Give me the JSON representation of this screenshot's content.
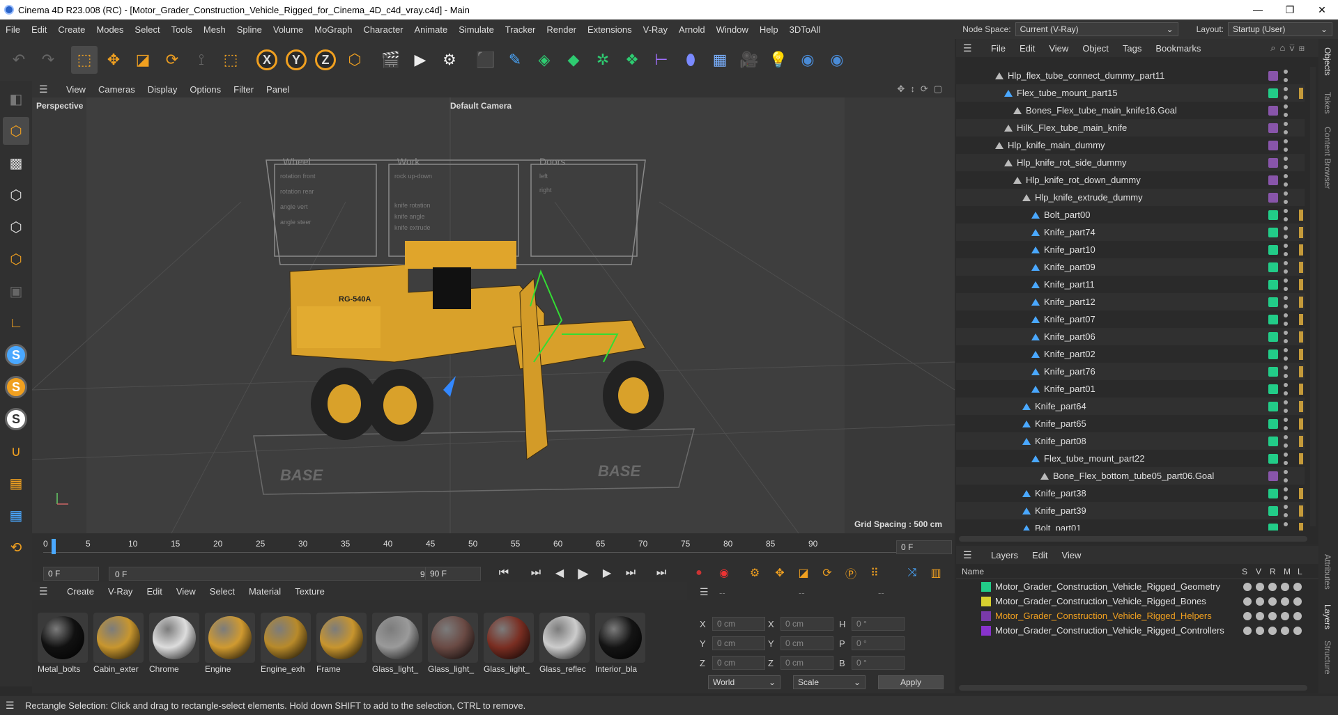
{
  "window": {
    "title": "Cinema 4D R23.008 (RC) - [Motor_Grader_Construction_Vehicle_Rigged_for_Cinema_4D_c4d_vray.c4d] - Main",
    "controls": [
      "—",
      "❐",
      "✕"
    ]
  },
  "menu": {
    "items": [
      "File",
      "Edit",
      "Create",
      "Modes",
      "Select",
      "Tools",
      "Mesh",
      "Spline",
      "Volume",
      "MoGraph",
      "Character",
      "Animate",
      "Simulate",
      "Tracker",
      "Render",
      "Extensions",
      "V-Ray",
      "Arnold",
      "Window",
      "Help",
      "3DToAll"
    ],
    "node_space_label": "Node Space:",
    "node_space_value": "Current (V-Ray)",
    "layout_label": "Layout:",
    "layout_value": "Startup (User)"
  },
  "viewport": {
    "menu": [
      "View",
      "Cameras",
      "Display",
      "Options",
      "Filter",
      "Panel"
    ],
    "view_name": "Perspective",
    "camera": "Default Camera",
    "grid_spacing": "Grid Spacing : 500 cm",
    "model_label": "RG-540A",
    "board": {
      "sections": [
        "Wheel",
        "Work",
        "Doors"
      ],
      "wheel_items": [
        "rotation front",
        "rotation rear",
        "angle vert",
        "angle steer"
      ],
      "work_items": [
        "rock up-down",
        "knife rotation",
        "knife angle",
        "knife extrude"
      ],
      "door_items": [
        "left",
        "right"
      ],
      "base_label": "BASE"
    }
  },
  "timeline": {
    "ticks": [
      "0",
      "5",
      "10",
      "15",
      "20",
      "25",
      "30",
      "35",
      "40",
      "45",
      "50",
      "55",
      "60",
      "65",
      "70",
      "75",
      "80",
      "85",
      "90"
    ],
    "current_frame": "0 F",
    "start_frame": "0 F",
    "range_start": "0 F",
    "range_end": "90 F",
    "end_frame": "90 F"
  },
  "materials": {
    "menu": [
      "Create",
      "V-Ray",
      "Edit",
      "View",
      "Select",
      "Material",
      "Texture"
    ],
    "items": [
      {
        "name": "Metal_bolts",
        "color": "#111111"
      },
      {
        "name": "Cabin_exter",
        "color": "#c8962e"
      },
      {
        "name": "Chrome",
        "color": "#dddddd"
      },
      {
        "name": "Engine",
        "color": "#d09a30"
      },
      {
        "name": "Engine_exh",
        "color": "#b88a2a"
      },
      {
        "name": "Frame",
        "color": "#c8952e"
      },
      {
        "name": "Glass_light_",
        "color": "#9a9a9a"
      },
      {
        "name": "Glass_light_",
        "color": "#6a4a44"
      },
      {
        "name": "Glass_light_",
        "color": "#7a2e22"
      },
      {
        "name": "Glass_reflec",
        "color": "#cccccc"
      },
      {
        "name": "Interior_bla",
        "color": "#141414"
      }
    ]
  },
  "coords": {
    "headers": [
      "--",
      "--",
      "--"
    ],
    "rows": [
      {
        "a": "X",
        "av": "0 cm",
        "b": "X",
        "bv": "0 cm",
        "c": "H",
        "cv": "0 °"
      },
      {
        "a": "Y",
        "av": "0 cm",
        "b": "Y",
        "bv": "0 cm",
        "c": "P",
        "cv": "0 °"
      },
      {
        "a": "Z",
        "av": "0 cm",
        "b": "Z",
        "bv": "0 cm",
        "c": "B",
        "cv": "0 °"
      }
    ],
    "mode": "World",
    "transform": "Scale",
    "apply": "Apply"
  },
  "objects": {
    "menu": [
      "File",
      "Edit",
      "View",
      "Object",
      "Tags",
      "Bookmarks"
    ],
    "rows": [
      {
        "name": "Hlp_flex_tube_connect_dummy_part11",
        "chip": "#8855aa",
        "depth": 0
      },
      {
        "name": "Flex_tube_mount_part15",
        "chip": "#22cc88",
        "depth": 1
      },
      {
        "name": "Bones_Flex_tube_main_knife16.Goal",
        "chip": "#8855aa",
        "depth": 2
      },
      {
        "name": "HilK_Flex_tube_main_knife",
        "chip": "#8855aa",
        "depth": 1
      },
      {
        "name": "Hlp_knife_main_dummy",
        "chip": "#8855aa",
        "depth": 0
      },
      {
        "name": "Hlp_knife_rot_side_dummy",
        "chip": "#8855aa",
        "depth": 1
      },
      {
        "name": "Hlp_knife_rot_down_dummy",
        "chip": "#8855aa",
        "depth": 2
      },
      {
        "name": "Hlp_knife_extrude_dummy",
        "chip": "#8855aa",
        "depth": 3
      },
      {
        "name": "Bolt_part00",
        "chip": "#22cc88",
        "depth": 4
      },
      {
        "name": "Knife_part74",
        "chip": "#22cc88",
        "depth": 4
      },
      {
        "name": "Knife_part10",
        "chip": "#22cc88",
        "depth": 4
      },
      {
        "name": "Knife_part09",
        "chip": "#22cc88",
        "depth": 4
      },
      {
        "name": "Knife_part11",
        "chip": "#22cc88",
        "depth": 4
      },
      {
        "name": "Knife_part12",
        "chip": "#22cc88",
        "depth": 4
      },
      {
        "name": "Knife_part07",
        "chip": "#22cc88",
        "depth": 4
      },
      {
        "name": "Knife_part06",
        "chip": "#22cc88",
        "depth": 4
      },
      {
        "name": "Knife_part02",
        "chip": "#22cc88",
        "depth": 4
      },
      {
        "name": "Knife_part76",
        "chip": "#22cc88",
        "depth": 4
      },
      {
        "name": "Knife_part01",
        "chip": "#22cc88",
        "depth": 4
      },
      {
        "name": "Knife_part64",
        "chip": "#22cc88",
        "depth": 3
      },
      {
        "name": "Knife_part65",
        "chip": "#22cc88",
        "depth": 3
      },
      {
        "name": "Knife_part08",
        "chip": "#22cc88",
        "depth": 3
      },
      {
        "name": "Flex_tube_mount_part22",
        "chip": "#22cc88",
        "depth": 4
      },
      {
        "name": "Bone_Flex_bottom_tube05_part06.Goal",
        "chip": "#8855aa",
        "depth": 5
      },
      {
        "name": "Knife_part38",
        "chip": "#22cc88",
        "depth": 3
      },
      {
        "name": "Knife_part39",
        "chip": "#22cc88",
        "depth": 3
      },
      {
        "name": "Bolt_part01",
        "chip": "#22cc88",
        "depth": 3
      }
    ]
  },
  "layers": {
    "menu": [
      "Layers",
      "Edit",
      "View"
    ],
    "col_name": "Name",
    "col_flags": [
      "S",
      "V",
      "R",
      "M",
      "L"
    ],
    "rows": [
      {
        "name": "Motor_Grader_Construction_Vehicle_Rigged_Geometry",
        "color": "#22cc88",
        "highlight": false
      },
      {
        "name": "Motor_Grader_Construction_Vehicle_Rigged_Bones",
        "color": "#d8d030",
        "highlight": false
      },
      {
        "name": "Motor_Grader_Construction_Vehicle_Rigged_Helpers",
        "color": "#7a3aaa",
        "highlight": true
      },
      {
        "name": "Motor_Grader_Construction_Vehicle_Rigged_Controllers",
        "color": "#8833cc",
        "highlight": false
      }
    ]
  },
  "side_tabs": [
    "Objects",
    "Takes",
    "Content Browser",
    "Attributes",
    "Layers",
    "Structure"
  ],
  "status": "Rectangle Selection: Click and drag to rectangle-select elements. Hold down SHIFT to add to the selection, CTRL to remove.",
  "colors": {
    "accent": "#f0a020",
    "highlight_text": "#f0a020"
  }
}
